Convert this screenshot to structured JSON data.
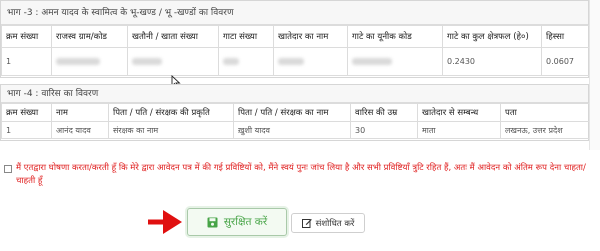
{
  "section3": {
    "title": "भाग -3 : अमन यादव के स्वामित्व के भू-खण्ड / भू -खण्डों का विवरण",
    "headers": [
      "क्रम संख्या",
      "राजस्व ग्राम/कोड",
      "खतौनी / खाता संख्या",
      "गाटा संख्या",
      "खातेदार का नाम",
      "गाटे का यूनीक कोड",
      "गाटे का कुल क्षेत्रफल (हे०)",
      "हिस्सा"
    ],
    "row": {
      "sno": "1",
      "area": "0.2430",
      "share": "0.0607"
    }
  },
  "section4": {
    "title": "भाग -4 : वारिस का विवरण",
    "headers": [
      "क्रम संख्या",
      "नाम",
      "पिता / पति / संरक्षक की प्रकृति",
      "पिता / पति / संरक्षक का नाम",
      "वारिस की उम्र",
      "खातेदार से सम्बन्ध",
      "पता"
    ],
    "row": {
      "sno": "1",
      "name": "आनंद यादव",
      "guardian_type": "संरक्षक का नाम",
      "guardian_name": "ख़ुशी यादव",
      "age": "30",
      "relation": "माता",
      "address": "लखनऊ, उत्तर प्रदेश"
    }
  },
  "declaration": {
    "text": "मैं एतद्वारा घोषणा करता/करती हूँ कि मेरे द्वारा आवेदन पत्र में की गई प्रविष्टियों को, मैंने स्वयं पुनः जांच लिया है और सभी प्रविष्टियाँ त्रुटि रहित हैं, अतः मैं आवेदन को अंतिम रूप देना चाहता/ चाहती हूँ"
  },
  "buttons": {
    "save_label": "सुरक्षित करें",
    "edit_label": "संशोधित करें"
  },
  "colors": {
    "declaration_text": "#e02020",
    "save_green": "#47a447",
    "arrow_red": "#e01010"
  },
  "icons": [
    "floppy-disk-icon",
    "edit-icon",
    "arrow-right-icon",
    "mouse-cursor-icon"
  ]
}
